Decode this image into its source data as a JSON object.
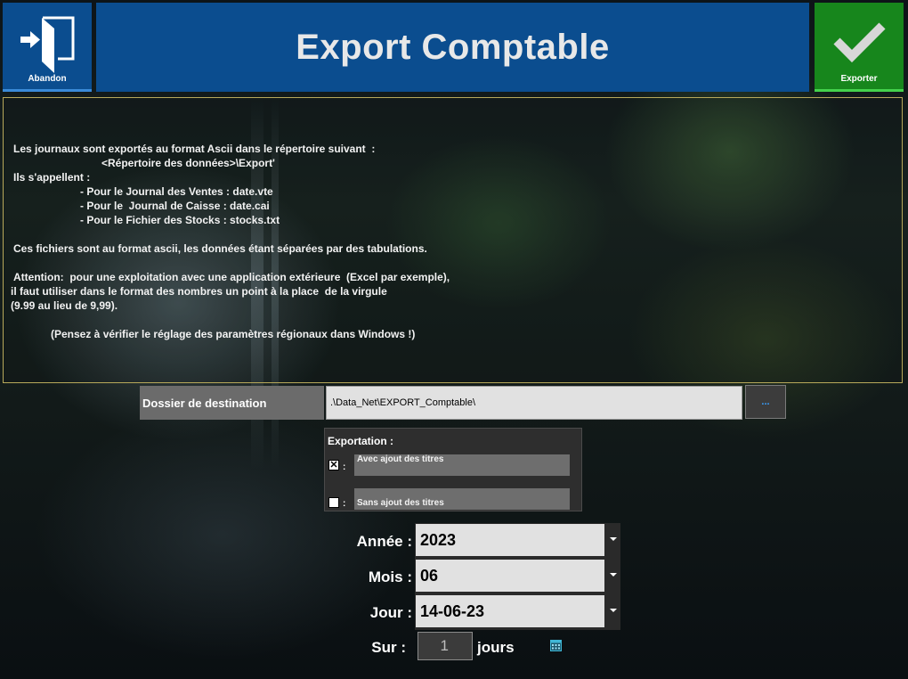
{
  "header": {
    "title": "Export Comptable",
    "abandon_label": "Abandon",
    "export_label": "Exporter"
  },
  "info": {
    "lines": [
      "Les journaux sont exportés au format Ascii dans le répertoire suivant  :",
      "<Répertoire des données>\\Export'",
      "Ils s'appellent :",
      "- Pour le Journal des Ventes : date.vte",
      "- Pour le  Journal de Caisse : date.cai",
      "- Pour le Fichier des Stocks : stocks.txt",
      "Ces fichiers sont au format ascii, les données étant séparées par des tabulations.",
      "Attention:  pour une exploitation avec une application extérieure  (Excel par exemple),",
      "il faut utiliser dans le format des nombres un point à la place  de la virgule",
      "(9.99 au lieu de 9,99).",
      "(Pensez à vérifier le réglage des paramètres régionaux dans Windows !)"
    ]
  },
  "destination": {
    "label": "Dossier de destination",
    "value": ".\\Data_Net\\EXPORT_Comptable\\",
    "browse_label": "..."
  },
  "exportation": {
    "title": "Exportation :",
    "options": [
      {
        "label": "Avec ajout des titres",
        "checked": true,
        "mark": "✕"
      },
      {
        "label": "Sans ajout des titres",
        "checked": false,
        "mark": ""
      }
    ],
    "colon": ":"
  },
  "fields": {
    "annee": {
      "label": "Année :",
      "value": "2023"
    },
    "mois": {
      "label": "Mois :",
      "value": "06"
    },
    "jour": {
      "label": "Jour :",
      "value": "14-06-23"
    },
    "sur": {
      "label": "Sur :",
      "value": "1",
      "unit": "jours"
    }
  },
  "icons": {
    "abandon": "exit-door-icon",
    "export": "checkmark-icon",
    "calendar": "calendar-icon"
  },
  "colors": {
    "header_blue": "#0b4d8f",
    "export_green": "#17861c",
    "browse_text": "#39a0ff",
    "panel_border": "#b8a95a"
  }
}
